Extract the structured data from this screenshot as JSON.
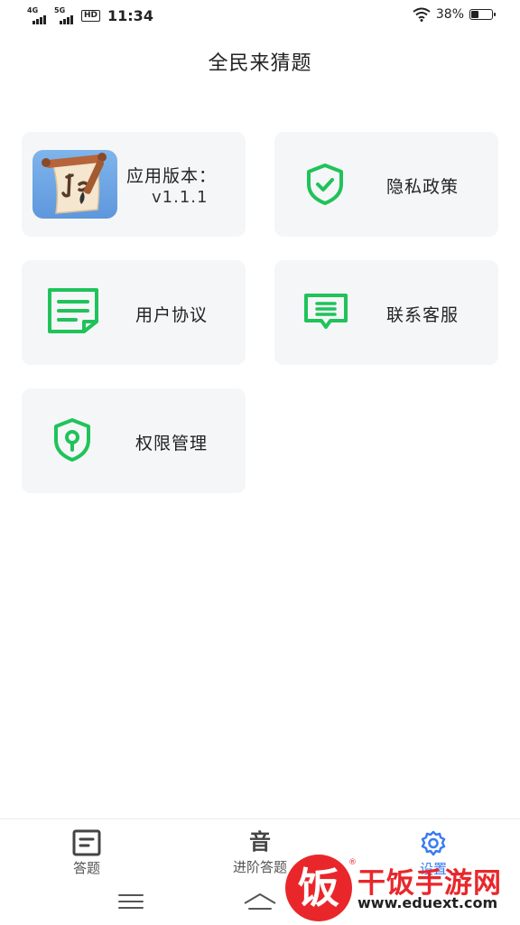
{
  "status_bar": {
    "signal1_label": "4G",
    "signal2_label": "5G",
    "hd_label": "HD",
    "time": "11:34",
    "battery_text": "38%",
    "battery_level": 0.38
  },
  "page": {
    "title": "全民来猜题"
  },
  "cards": {
    "version": {
      "label": "应用版本：",
      "value": "v1.1.1"
    },
    "privacy": {
      "label": "隐私政策",
      "icon": "shield-check-icon"
    },
    "agreement": {
      "label": "用户协议",
      "icon": "document-icon"
    },
    "service": {
      "label": "联系客服",
      "icon": "chat-bubble-icon"
    },
    "permissions": {
      "label": "权限管理",
      "icon": "shield-keyhole-icon"
    }
  },
  "tab_bar": {
    "tabs": [
      {
        "label": "答题",
        "icon": "answer-board-icon",
        "active": false
      },
      {
        "label": "进阶答题",
        "icon_glyph": "音",
        "active": false
      },
      {
        "label": "设置",
        "icon": "gear-icon",
        "active": true
      }
    ]
  },
  "watermark": {
    "glyph": "饭",
    "text": "干饭手游网",
    "url": "www.eduext.com",
    "reg": "®"
  },
  "colors": {
    "accent_green": "#1fc35a",
    "active_tab": "#3b7cf0",
    "card_bg": "#f5f6f8",
    "watermark_red": "#e9272b"
  }
}
